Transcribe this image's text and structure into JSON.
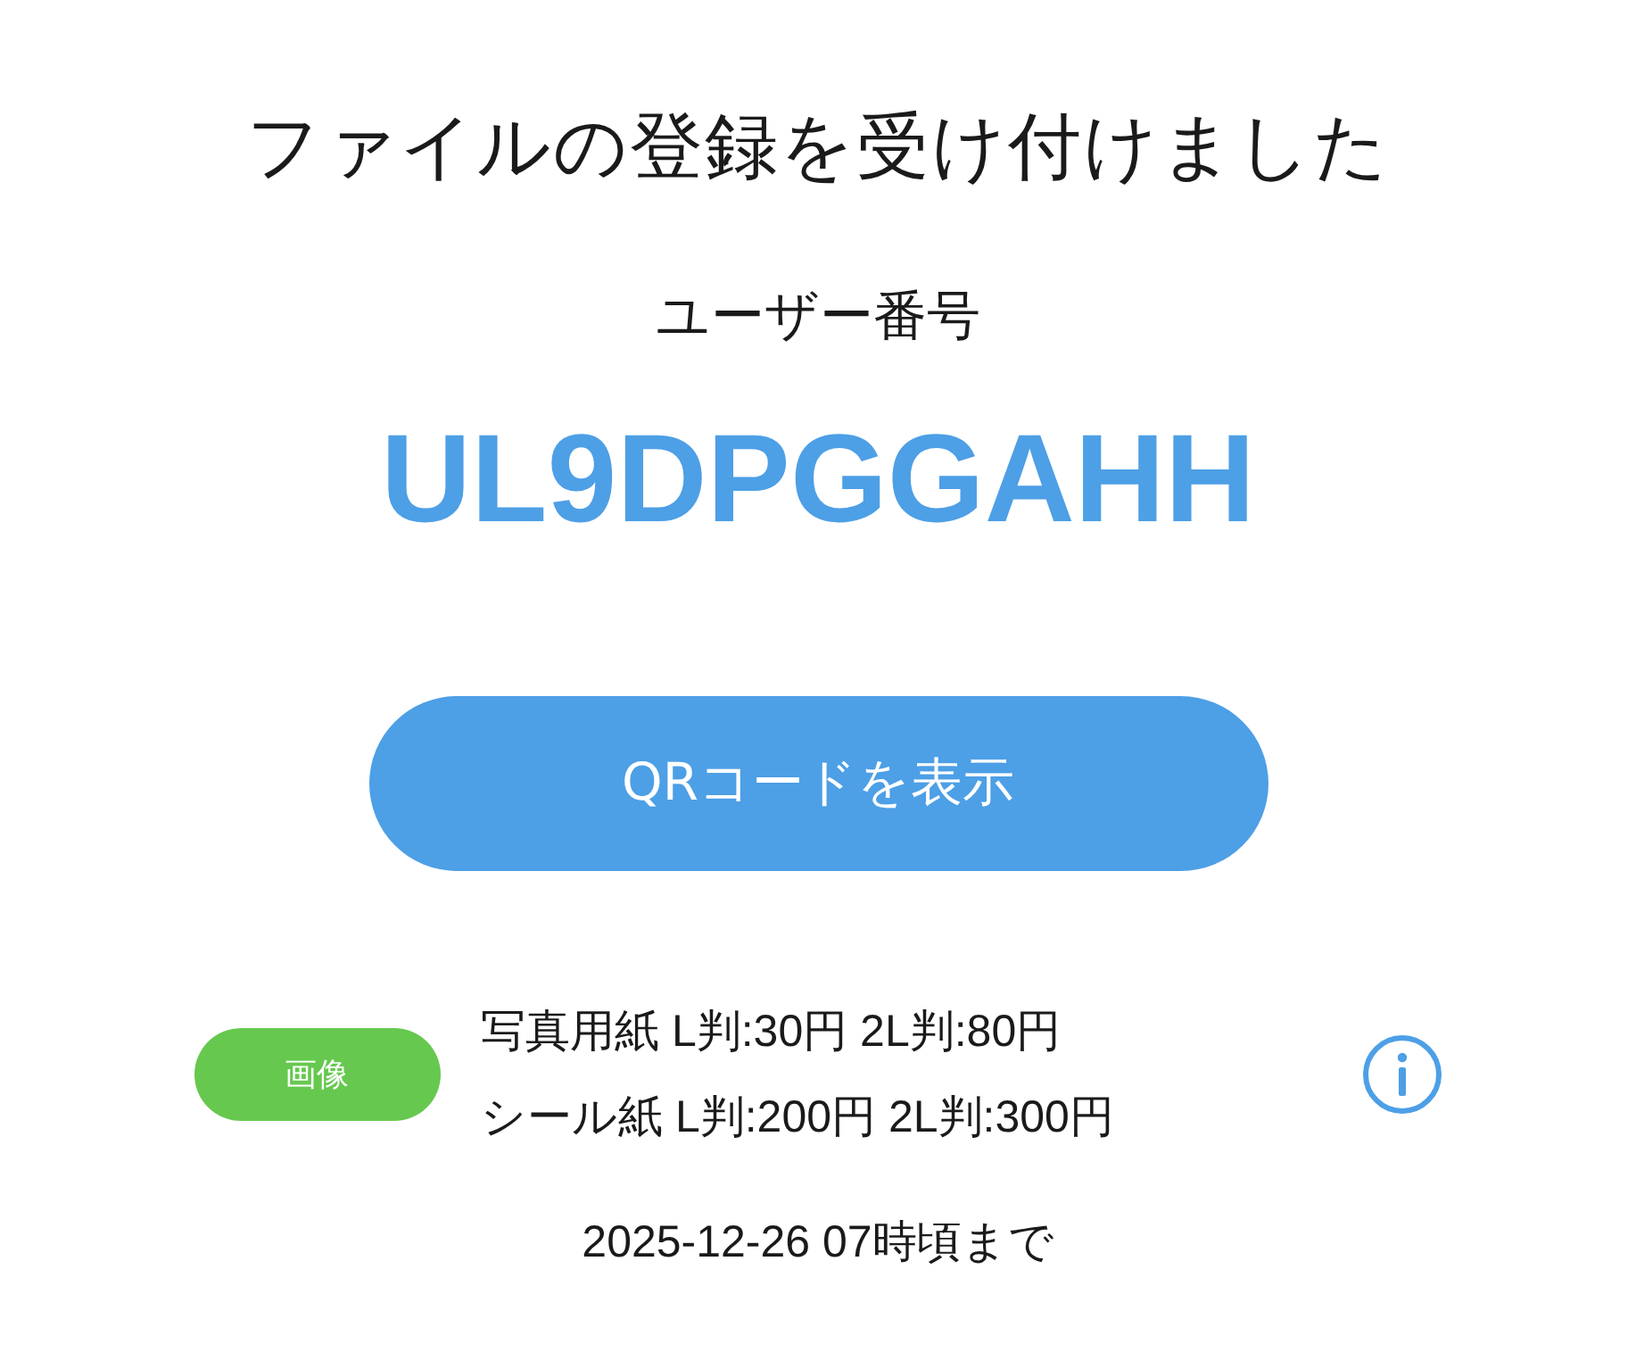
{
  "title": "ファイルの登録を受け付けました",
  "user_number": {
    "label": "ユーザー番号",
    "value": "UL9DPGGAHH"
  },
  "qr_button": {
    "label": "QRコードを表示"
  },
  "file": {
    "badge": "画像",
    "color": "#66c84f",
    "prices": [
      "写真用紙 L判:30円 2L判:80円",
      "シール紙 L判:200円 2L判:300円"
    ]
  },
  "deadline": "2025-12-26 07時頃まで"
}
